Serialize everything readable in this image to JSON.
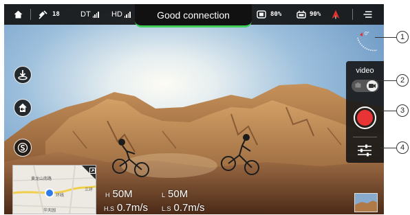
{
  "status_bar": {
    "satellite_count": "18",
    "dt_label": "DT",
    "hd_label": "HD",
    "connection_text": "Good connection",
    "drone_battery": "80%",
    "remote_battery": "90%"
  },
  "compass": {
    "heading": "0°"
  },
  "camera_panel": {
    "mode_label": "video"
  },
  "map": {
    "road_label_1": "黄龙山南路",
    "road_label_2": "环线",
    "road_label_3": "三环",
    "place_label": "华天园"
  },
  "telemetry": {
    "h_label": "H",
    "h_value": "50M",
    "l_label": "L",
    "l_value": "50M",
    "hs_label": "H.S",
    "hs_value": "0.7m/s",
    "ls_label": "L.S",
    "ls_value": "0.7m/s"
  },
  "callouts": [
    "1",
    "2",
    "3",
    "4"
  ],
  "colors": {
    "connection_accent": "#3fcf5a",
    "record_red": "#e83434",
    "home_marker": "#e0302c"
  },
  "icons": [
    "home-icon",
    "satellite-icon",
    "signal-icon",
    "drone-battery-icon",
    "remote-battery-icon",
    "home-point-icon",
    "menu-icon",
    "takeoff-icon",
    "return-home-icon",
    "settings-s-icon",
    "camera-icon",
    "video-icon",
    "sliders-icon",
    "expand-icon",
    "compass-arc-icon"
  ]
}
